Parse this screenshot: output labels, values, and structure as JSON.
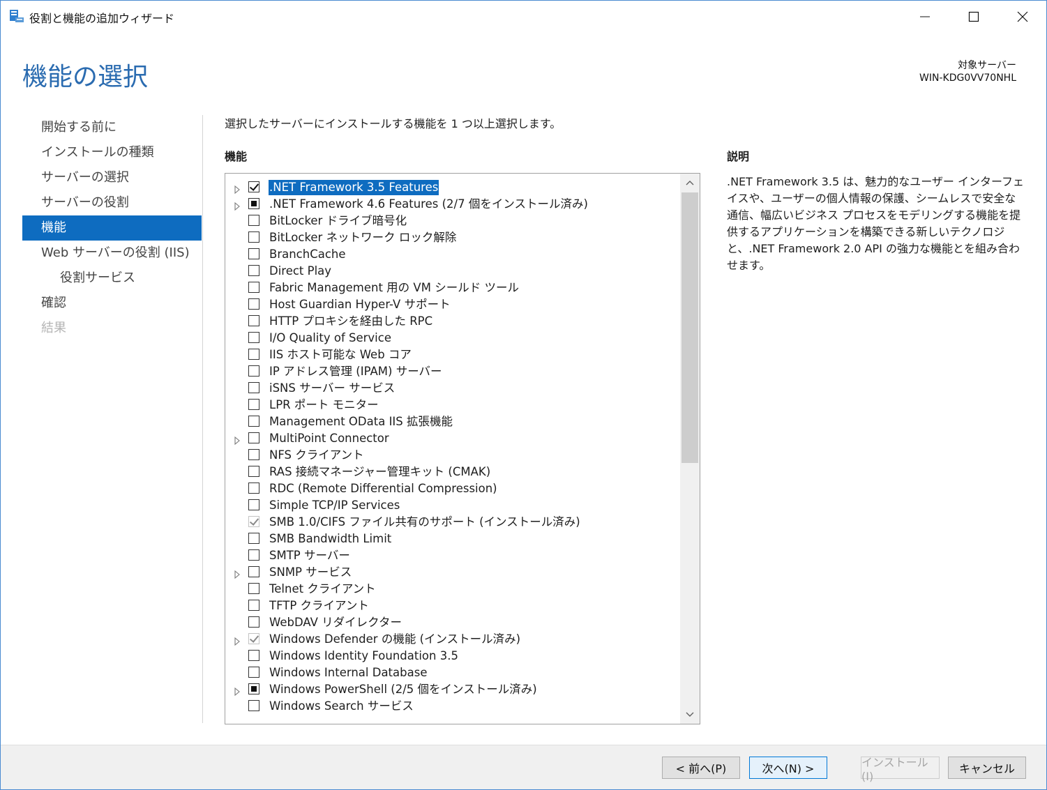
{
  "window": {
    "title": "役割と機能の追加ウィザード"
  },
  "header": {
    "page_title": "機能の選択",
    "target_server_label": "対象サーバー",
    "target_server_name": "WIN-KDG0VV70NHL"
  },
  "nav": {
    "items": [
      {
        "label": "開始する前に",
        "state": "normal",
        "level": 0
      },
      {
        "label": "インストールの種類",
        "state": "normal",
        "level": 0
      },
      {
        "label": "サーバーの選択",
        "state": "normal",
        "level": 0
      },
      {
        "label": "サーバーの役割",
        "state": "normal",
        "level": 0
      },
      {
        "label": "機能",
        "state": "active",
        "level": 0
      },
      {
        "label": "Web サーバーの役割 (IIS)",
        "state": "normal",
        "level": 0
      },
      {
        "label": "役割サービス",
        "state": "normal",
        "level": 1
      },
      {
        "label": "確認",
        "state": "normal",
        "level": 0
      },
      {
        "label": "結果",
        "state": "disabled",
        "level": 0
      }
    ]
  },
  "content": {
    "instruction": "選択したサーバーにインストールする機能を 1 つ以上選択します。",
    "features_label": "機能",
    "description_label": "説明",
    "description_text": ".NET Framework 3.5 は、魅力的なユーザー インターフェイスや、ユーザーの個人情報の保護、シームレスで安全な通信、幅広いビジネス プロセスをモデリングする機能を提供するアプリケーションを構築できる新しいテクノロジと、.NET Framework 2.0 API の強力な機能とを組み合わせます。"
  },
  "features": [
    {
      "label": ".NET Framework 3.5 Features",
      "check": "checked",
      "expandable": true,
      "selected": true
    },
    {
      "label": ".NET Framework 4.6 Features (2/7 個をインストール済み)",
      "check": "partial",
      "expandable": true
    },
    {
      "label": "BitLocker ドライブ暗号化",
      "check": "none",
      "expandable": false
    },
    {
      "label": "BitLocker ネットワーク ロック解除",
      "check": "none",
      "expandable": false
    },
    {
      "label": "BranchCache",
      "check": "none",
      "expandable": false
    },
    {
      "label": "Direct Play",
      "check": "none",
      "expandable": false
    },
    {
      "label": "Fabric Management 用の VM シールド ツール",
      "check": "none",
      "expandable": false
    },
    {
      "label": "Host Guardian Hyper-V サポート",
      "check": "none",
      "expandable": false
    },
    {
      "label": "HTTP プロキシを経由した RPC",
      "check": "none",
      "expandable": false
    },
    {
      "label": "I/O Quality of Service",
      "check": "none",
      "expandable": false
    },
    {
      "label": "IIS ホスト可能な Web コア",
      "check": "none",
      "expandable": false
    },
    {
      "label": "IP アドレス管理 (IPAM) サーバー",
      "check": "none",
      "expandable": false
    },
    {
      "label": "iSNS サーバー サービス",
      "check": "none",
      "expandable": false
    },
    {
      "label": "LPR ポート モニター",
      "check": "none",
      "expandable": false
    },
    {
      "label": "Management OData IIS 拡張機能",
      "check": "none",
      "expandable": false
    },
    {
      "label": "MultiPoint Connector",
      "check": "none",
      "expandable": true
    },
    {
      "label": "NFS クライアント",
      "check": "none",
      "expandable": false
    },
    {
      "label": "RAS 接続マネージャー管理キット (CMAK)",
      "check": "none",
      "expandable": false
    },
    {
      "label": "RDC (Remote Differential Compression)",
      "check": "none",
      "expandable": false
    },
    {
      "label": "Simple TCP/IP Services",
      "check": "none",
      "expandable": false
    },
    {
      "label": "SMB 1.0/CIFS ファイル共有のサポート (インストール済み)",
      "check": "installed",
      "expandable": false
    },
    {
      "label": "SMB Bandwidth Limit",
      "check": "none",
      "expandable": false
    },
    {
      "label": "SMTP サーバー",
      "check": "none",
      "expandable": false
    },
    {
      "label": "SNMP サービス",
      "check": "none",
      "expandable": true
    },
    {
      "label": "Telnet クライアント",
      "check": "none",
      "expandable": false
    },
    {
      "label": "TFTP クライアント",
      "check": "none",
      "expandable": false
    },
    {
      "label": "WebDAV リダイレクター",
      "check": "none",
      "expandable": false
    },
    {
      "label": "Windows Defender の機能 (インストール済み)",
      "check": "installed",
      "expandable": true
    },
    {
      "label": "Windows Identity Foundation 3.5",
      "check": "none",
      "expandable": false
    },
    {
      "label": "Windows Internal Database",
      "check": "none",
      "expandable": false
    },
    {
      "label": "Windows PowerShell (2/5 個をインストール済み)",
      "check": "partial",
      "expandable": true
    },
    {
      "label": "Windows Search サービス",
      "check": "none",
      "expandable": false
    }
  ],
  "footer": {
    "prev_label": "< 前へ(P)",
    "next_label": "次へ(N) >",
    "install_label": "インストール(I)",
    "cancel_label": "キャンセル"
  },
  "colors": {
    "accent": "#0e6cc0",
    "title_blue": "#2a6bb0",
    "disabled_text": "#b5b5b5"
  },
  "icons": [
    "server-manager-icon",
    "minimize-icon",
    "maximize-icon",
    "close-icon",
    "expand-arrow-icon",
    "scroll-up-icon",
    "scroll-down-icon"
  ]
}
